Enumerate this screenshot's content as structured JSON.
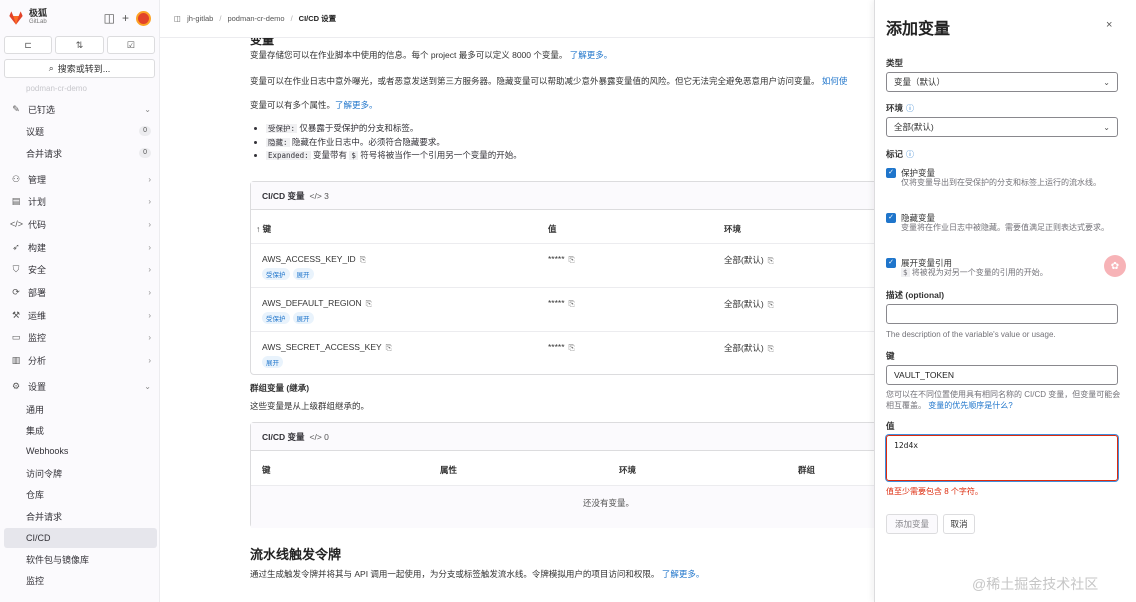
{
  "sidebar": {
    "brand_name": "极狐",
    "brand_sub": "GitLab",
    "search_label": "搜索或转到...",
    "faded_project": "podman-cr-demo",
    "items": [
      {
        "label": "已钉选",
        "icon": "pin-icon",
        "chev": "⌄"
      },
      {
        "label": "议题",
        "count": "0"
      },
      {
        "label": "合并请求",
        "count": "0"
      },
      {
        "label": "管理",
        "icon": "users-icon",
        "chev": "›"
      },
      {
        "label": "计划",
        "icon": "plan-icon",
        "chev": "›"
      },
      {
        "label": "代码",
        "icon": "code-icon",
        "chev": "›"
      },
      {
        "label": "构建",
        "icon": "rocket-icon",
        "chev": "›"
      },
      {
        "label": "安全",
        "icon": "shield-icon",
        "chev": "›"
      },
      {
        "label": "部署",
        "icon": "deploy-icon",
        "chev": "›"
      },
      {
        "label": "运维",
        "icon": "operate-icon",
        "chev": "›"
      },
      {
        "label": "监控",
        "icon": "monitor-icon",
        "chev": "›"
      },
      {
        "label": "分析",
        "icon": "chart-icon",
        "chev": "›"
      },
      {
        "label": "设置",
        "icon": "gear-icon",
        "chev": "⌄"
      },
      {
        "label": "通用"
      },
      {
        "label": "集成"
      },
      {
        "label": "Webhooks"
      },
      {
        "label": "访问令牌"
      },
      {
        "label": "仓库"
      },
      {
        "label": "合并请求"
      },
      {
        "label": "CI/CD",
        "active": true
      },
      {
        "label": "软件包与镜像库"
      },
      {
        "label": "监控"
      }
    ]
  },
  "breadcrumb": [
    "jh-gitlab",
    "podman-cr-demo",
    "CI/CD 设置"
  ],
  "main": {
    "heading_cut": "变量",
    "p1": "变量存储您可以在作业脚本中使用的信息。每个 project 最多可以定义 8000 个变量。",
    "p1_link": "了解更多。",
    "p2": "变量可以在作业日志中意外曝光，或者恶意发送到第三方服务器。隐藏变量可以帮助减少意外暴露变量值的风险。但它无法完全避免恶意用户访问变量。",
    "p2_link": "如何使",
    "p3": "变量可以有多个属性。",
    "p3_link": "了解更多。",
    "bullets": [
      {
        "code": "受保护:",
        "text": "仅暴露于受保护的分支和标签。"
      },
      {
        "code": "隐藏:",
        "text": "隐藏在作业日志中。必须符合隐藏要求。"
      },
      {
        "code": "Expanded:",
        "text": "变量带有",
        "code2": "$",
        "text2": "符号将被当作一个引用另一个变量的开始。"
      }
    ],
    "table1": {
      "title": "CI/CD 变量",
      "count": "</> 3",
      "col_key": "↑ 键",
      "col_value": "值",
      "col_env": "环境",
      "rows": [
        {
          "key": "AWS_ACCESS_KEY_ID",
          "value": "*****",
          "env": "全部(默认)",
          "badges": [
            "受保护",
            "展开"
          ]
        },
        {
          "key": "AWS_DEFAULT_REGION",
          "value": "*****",
          "env": "全部(默认)",
          "badges": [
            "受保护",
            "展开"
          ]
        },
        {
          "key": "AWS_SECRET_ACCESS_KEY",
          "value": "*****",
          "env": "全部(默认)",
          "badges": [
            "展开"
          ]
        }
      ]
    },
    "group_title": "群组变量 (继承)",
    "group_desc": "这些变量是从上级群组继承的。",
    "table2": {
      "title": "CI/CD 变量",
      "count": "</> 0",
      "col_key": "键",
      "col_attr": "属性",
      "col_env": "环境",
      "col_group": "群组",
      "empty": "还没有变量。"
    },
    "trigger_title": "流水线触发令牌",
    "trigger_desc": "通过生成触发令牌并将其与 API 调用一起使用，为分支或标签触发流水线。令牌模拟用户的项目访问和权限。",
    "trigger_link": "了解更多。"
  },
  "drawer": {
    "title": "添加变量",
    "close": "×",
    "type_label": "类型",
    "type_value": "变量（默认）",
    "env_label": "环境",
    "env_value": "全部(默认)",
    "flags_label": "标记",
    "flags": [
      {
        "title": "保护变量",
        "desc": "仅将变量导出到在受保护的分支和标签上运行的流水线。"
      },
      {
        "title": "隐藏变量",
        "desc": "变量将在作业日志中被隐藏。需要值满足正则表达式要求。"
      },
      {
        "title": "展开变量引用",
        "desc_code": "$",
        "desc": "将被视为对另一个变量的引用的开始。"
      }
    ],
    "desc_label": "描述 (optional)",
    "desc_value": "",
    "desc_hint": "The description of the variable's value or usage.",
    "key_label": "键",
    "key_value": "VAULT_TOKEN",
    "key_hint": "您可以在不同位置使用具有相同名称的 CI/CD 变量，但变量可能会相互覆盖。",
    "key_hint_link": "变量的优先顺序是什么?",
    "value_label": "值",
    "value_value": "12d4x",
    "error": "值至少需要包含 8 个字符。",
    "add_button": "添加变量",
    "cancel_button": "取消"
  },
  "watermark": "@稀土掘金技术社区",
  "colors": {
    "accent": "#1f75cb",
    "error": "#dd2b0e",
    "brand": "#e24329"
  }
}
